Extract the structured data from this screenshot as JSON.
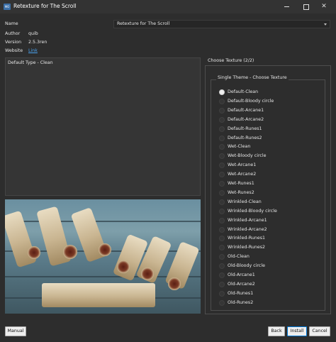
{
  "window": {
    "icon": "app-icon",
    "icon_text": "MO",
    "title": "Retexture for The Scroll",
    "close_glyph": "✕"
  },
  "info": {
    "name_label": "Name",
    "name_value": "Retexture for The Scroll",
    "author_label": "Author",
    "author_value": "quib",
    "version_label": "Version",
    "version_value": "2.5.3ren",
    "website_label": "Website",
    "website_link": "Link"
  },
  "description": "Default Type - Clean",
  "options_panel": {
    "group_title": "Choose Texture (2/2)",
    "subgroup_title": "Single Theme - Choose Texture",
    "selected_index": 0,
    "items": [
      "Default-Clean",
      "Default-Bloody circle",
      "Default-Arcane1",
      "Default-Arcane2",
      "Default-Runes1",
      "Default-Runes2",
      "Wet-Clean",
      "Wet-Bloody circle",
      "Wet-Arcane1",
      "Wet-Arcane2",
      "Wet-Runes1",
      "Wet-Runes2",
      "Wrinkled-Clean",
      "Wrinkled-Bloody circle",
      "Wrinkled-Arcane1",
      "Wrinkled-Arcane2",
      "Wrinkled-Runes1",
      "Wrinkled-Runes2",
      "Old-Clean",
      "Old-Bloody circle",
      "Old-Arcane1",
      "Old-Arcane2",
      "Old-Runes1",
      "Old-Runes2"
    ]
  },
  "buttons": {
    "manual": "Manual",
    "back": "Back",
    "install": "Install",
    "cancel": "Cancel"
  },
  "colors": {
    "background": "#2d2d2d",
    "link": "#4aa3f0",
    "default_button_border": "#0078d7"
  }
}
